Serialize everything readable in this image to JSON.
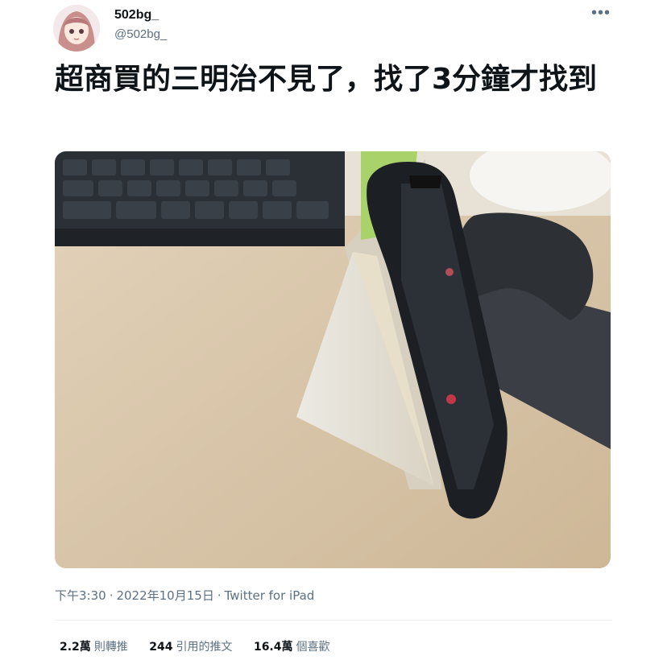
{
  "author": {
    "display_name": "502bg_",
    "handle": "@502bg_"
  },
  "more_icon": "more-horizontal-icon",
  "tweet": {
    "text": "超商買的三明治不見了，找了3分鐘才找到"
  },
  "meta": {
    "time": "下午3:30",
    "date": "2022年10月15日",
    "source": "Twitter for iPad",
    "separator": "·"
  },
  "stats": {
    "retweets_value": "2.2萬",
    "retweets_label": "則轉推",
    "quotes_value": "244",
    "quotes_label": "引用的推文",
    "likes_value": "16.4萬",
    "likes_label": "個喜歡"
  }
}
